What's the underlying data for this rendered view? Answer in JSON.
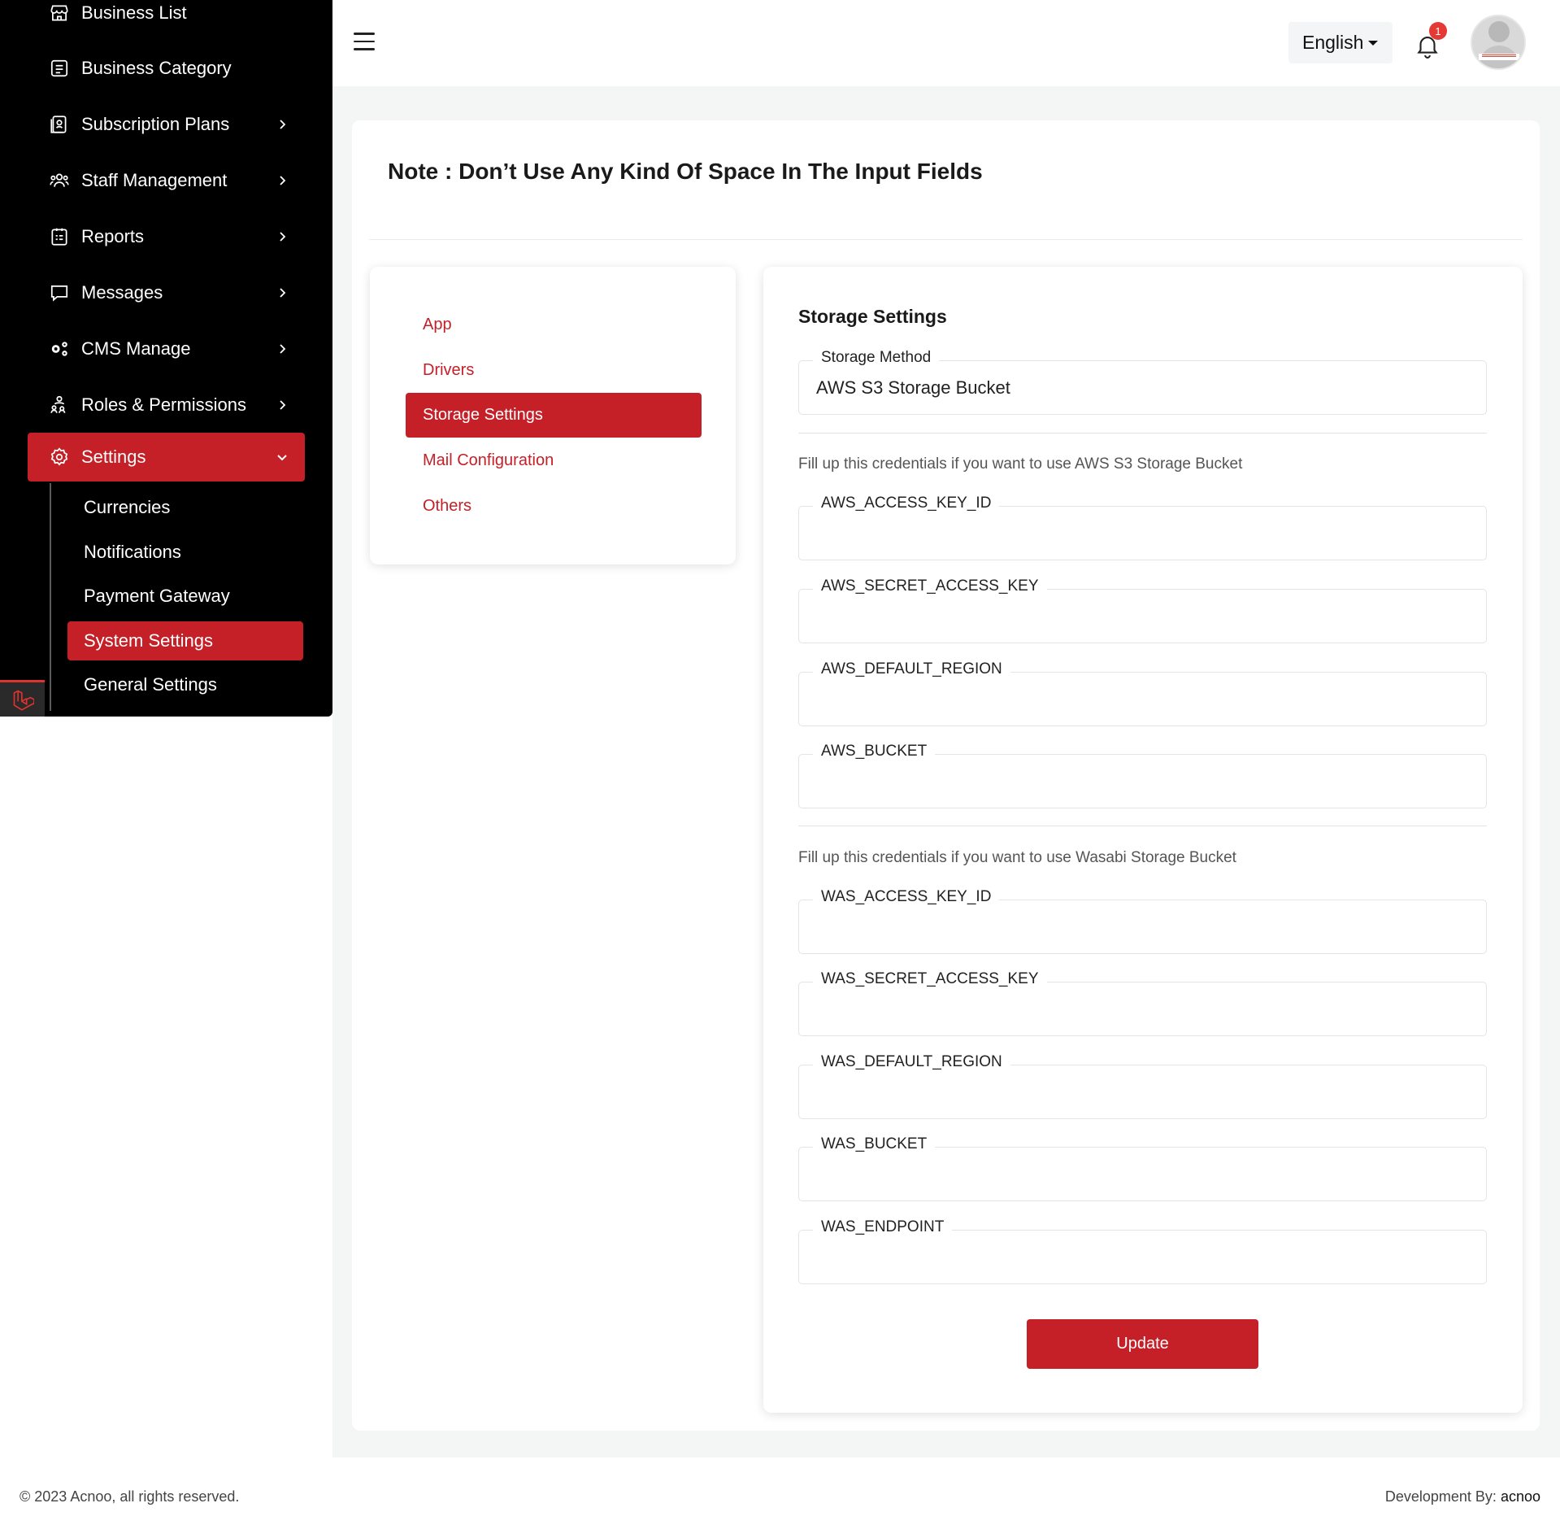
{
  "sidebar": {
    "items": [
      {
        "label": "Business List",
        "icon": "store-icon"
      },
      {
        "label": "Business Category",
        "icon": "list-icon"
      },
      {
        "label": "Subscription Plans",
        "icon": "subscription-icon"
      },
      {
        "label": "Staff Management",
        "icon": "staff-icon"
      },
      {
        "label": "Reports",
        "icon": "report-icon"
      },
      {
        "label": "Messages",
        "icon": "message-icon"
      },
      {
        "label": "CMS Manage",
        "icon": "cms-icon"
      },
      {
        "label": "Roles & Permissions",
        "icon": "roles-icon"
      },
      {
        "label": "Settings",
        "icon": "gear-icon"
      }
    ],
    "settings_sub": [
      {
        "label": "Currencies"
      },
      {
        "label": "Notifications"
      },
      {
        "label": "Payment Gateway"
      },
      {
        "label": "System Settings"
      },
      {
        "label": "General Settings"
      }
    ]
  },
  "header": {
    "language": "English",
    "notification_count": "1"
  },
  "note": "Note : Don’t Use Any Kind Of Space In The Input Fields",
  "settings_nav": [
    {
      "label": "App"
    },
    {
      "label": "Drivers"
    },
    {
      "label": "Storage Settings"
    },
    {
      "label": "Mail Configuration"
    },
    {
      "label": "Others"
    }
  ],
  "form": {
    "title": "Storage Settings",
    "storage_method_label": "Storage Method",
    "storage_method_value": "AWS S3 Storage Bucket",
    "aws_hint": "Fill up this credentials if you want to use AWS S3 Storage Bucket",
    "aws_fields": [
      {
        "label": "AWS_ACCESS_KEY_ID",
        "value": ""
      },
      {
        "label": "AWS_SECRET_ACCESS_KEY",
        "value": ""
      },
      {
        "label": "AWS_DEFAULT_REGION",
        "value": ""
      },
      {
        "label": "AWS_BUCKET",
        "value": ""
      }
    ],
    "was_hint": "Fill up this credentials if you want to use Wasabi Storage Bucket",
    "was_fields": [
      {
        "label": "WAS_ACCESS_KEY_ID",
        "value": ""
      },
      {
        "label": "WAS_SECRET_ACCESS_KEY",
        "value": ""
      },
      {
        "label": "WAS_DEFAULT_REGION",
        "value": ""
      },
      {
        "label": "WAS_BUCKET",
        "value": ""
      },
      {
        "label": "WAS_ENDPOINT",
        "value": ""
      }
    ],
    "update_label": "Update"
  },
  "footer": {
    "copyright": "© 2023 Acnoo, all rights reserved.",
    "dev_prefix": "Development By:",
    "dev_name": "acnoo"
  },
  "colors": {
    "accent": "#c51f27",
    "sidebar_bg": "#000000",
    "page_bg": "#f4f5f5"
  }
}
